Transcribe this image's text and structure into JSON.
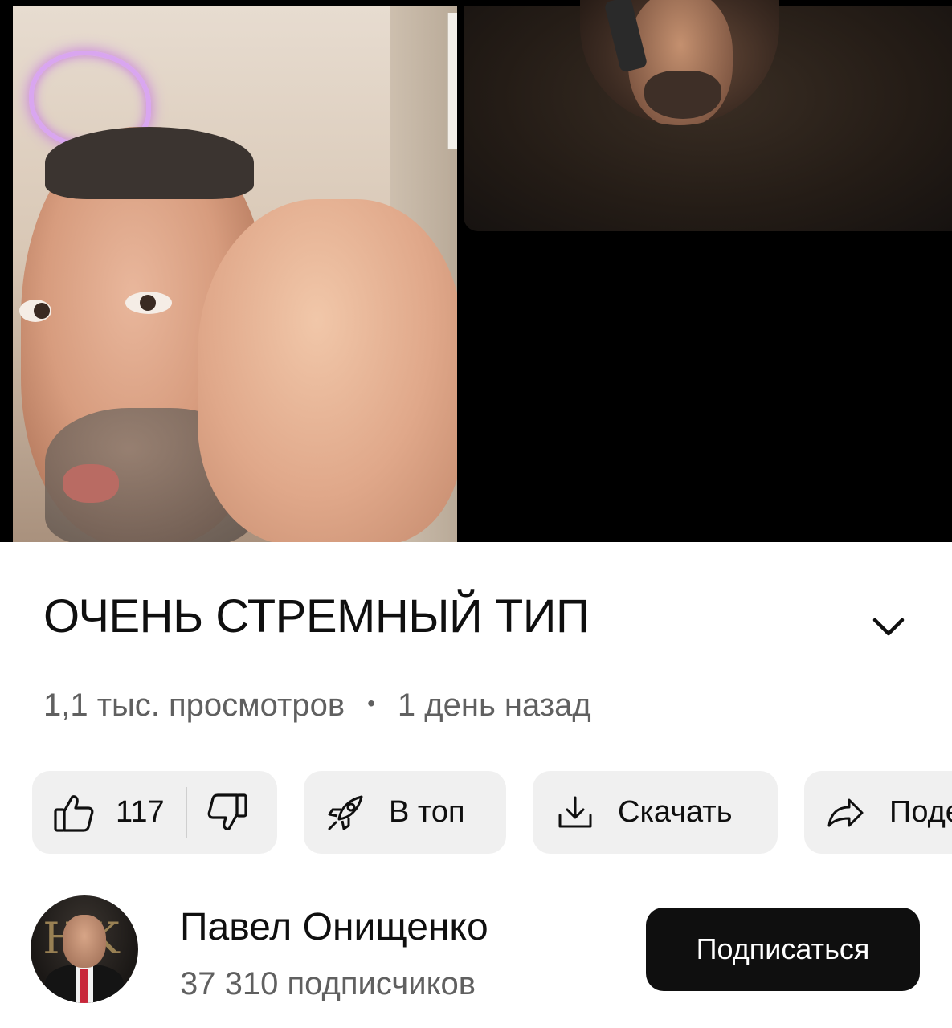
{
  "video": {
    "title": "ОЧЕНЬ СТРЕМНЫЙ ТИП",
    "views": "1,1 тыс. просмотров",
    "separator": "•",
    "published": "1 день назад"
  },
  "actions": {
    "like_count": "117",
    "top_label": "В топ",
    "download_label": "Скачать",
    "share_label": "Поде"
  },
  "channel": {
    "name": "Павел Онищенко",
    "subscribers": "37 310 подписчиков",
    "subscribe_label": "Подписаться"
  },
  "icons": {
    "expand": "chevron-down-icon",
    "like": "thumbs-up-icon",
    "dislike": "thumbs-down-icon",
    "top": "rocket-icon",
    "download": "download-icon",
    "share": "share-arrow-icon"
  },
  "colors": {
    "text_primary": "#0f0f0f",
    "text_secondary": "#606060",
    "chip_bg": "#f0f0f0",
    "subscribe_bg": "#0f0f0f",
    "subscribe_text": "#ffffff"
  }
}
